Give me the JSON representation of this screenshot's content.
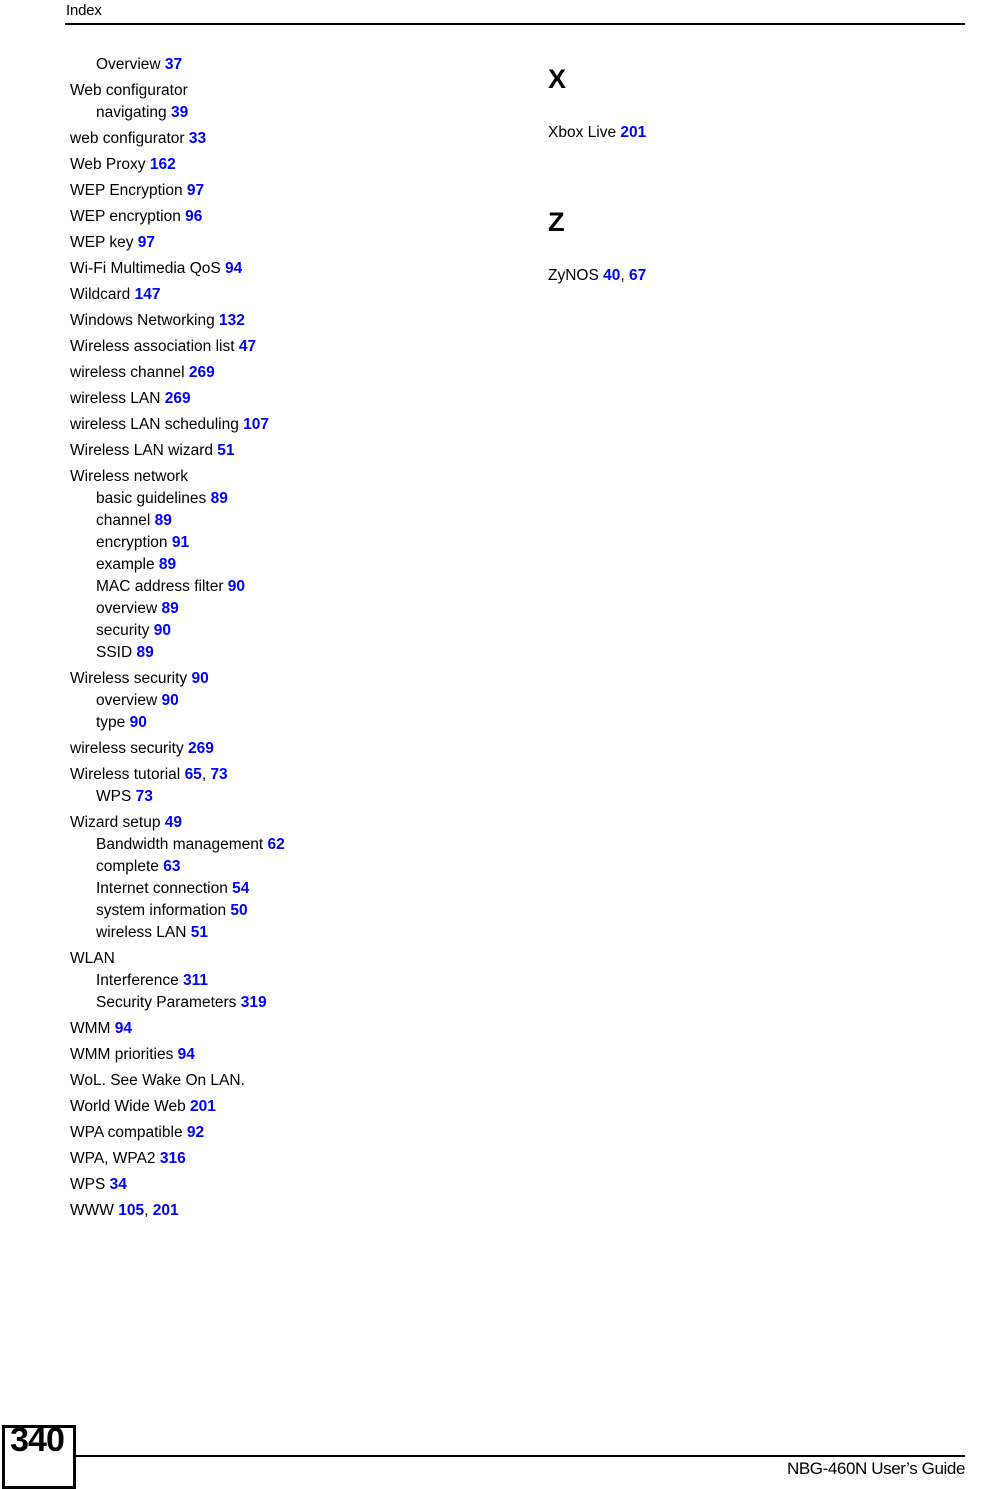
{
  "header": {
    "title": "Index"
  },
  "footer": {
    "page_number": "340",
    "guide_title": "NBG-460N User’s Guide"
  },
  "columns": {
    "left": {
      "entries": [
        {
          "label": "Overview",
          "level": 1,
          "pages": [
            "37"
          ]
        },
        {
          "label": "Web configurator",
          "level": 0,
          "pages": []
        },
        {
          "label": "navigating",
          "level": 1,
          "pages": [
            "39"
          ]
        },
        {
          "label": "web configurator",
          "level": 0,
          "pages": [
            "33"
          ]
        },
        {
          "label": "Web Proxy",
          "level": 0,
          "pages": [
            "162"
          ]
        },
        {
          "label": "WEP Encryption",
          "level": 0,
          "pages": [
            "97"
          ]
        },
        {
          "label": "WEP encryption",
          "level": 0,
          "pages": [
            "96"
          ]
        },
        {
          "label": "WEP key",
          "level": 0,
          "pages": [
            "97"
          ]
        },
        {
          "label": "Wi-Fi Multimedia QoS",
          "level": 0,
          "pages": [
            "94"
          ]
        },
        {
          "label": "Wildcard",
          "level": 0,
          "pages": [
            "147"
          ]
        },
        {
          "label": "Windows Networking",
          "level": 0,
          "pages": [
            "132"
          ]
        },
        {
          "label": "Wireless association list",
          "level": 0,
          "pages": [
            "47"
          ]
        },
        {
          "label": "wireless channel",
          "level": 0,
          "pages": [
            "269"
          ]
        },
        {
          "label": "wireless LAN",
          "level": 0,
          "pages": [
            "269"
          ]
        },
        {
          "label": "wireless LAN scheduling",
          "level": 0,
          "pages": [
            "107"
          ]
        },
        {
          "label": "Wireless LAN wizard",
          "level": 0,
          "pages": [
            "51"
          ]
        },
        {
          "label": "Wireless network",
          "level": 0,
          "pages": []
        },
        {
          "label": "basic guidelines",
          "level": 1,
          "pages": [
            "89"
          ]
        },
        {
          "label": "channel",
          "level": 1,
          "pages": [
            "89"
          ]
        },
        {
          "label": "encryption",
          "level": 1,
          "pages": [
            "91"
          ]
        },
        {
          "label": "example",
          "level": 1,
          "pages": [
            "89"
          ]
        },
        {
          "label": "MAC address filter",
          "level": 1,
          "pages": [
            "90"
          ]
        },
        {
          "label": "overview",
          "level": 1,
          "pages": [
            "89"
          ]
        },
        {
          "label": "security",
          "level": 1,
          "pages": [
            "90"
          ]
        },
        {
          "label": "SSID",
          "level": 1,
          "pages": [
            "89"
          ]
        },
        {
          "label": "Wireless security",
          "level": 0,
          "pages": [
            "90"
          ]
        },
        {
          "label": "overview",
          "level": 1,
          "pages": [
            "90"
          ]
        },
        {
          "label": "type",
          "level": 1,
          "pages": [
            "90"
          ]
        },
        {
          "label": "wireless security",
          "level": 0,
          "pages": [
            "269"
          ]
        },
        {
          "label": "Wireless tutorial",
          "level": 0,
          "pages": [
            "65",
            "73"
          ]
        },
        {
          "label": "WPS",
          "level": 1,
          "pages": [
            "73"
          ]
        },
        {
          "label": "Wizard setup",
          "level": 0,
          "pages": [
            "49"
          ]
        },
        {
          "label": "Bandwidth management",
          "level": 1,
          "pages": [
            "62"
          ]
        },
        {
          "label": "complete",
          "level": 1,
          "pages": [
            "63"
          ]
        },
        {
          "label": "Internet connection",
          "level": 1,
          "pages": [
            "54"
          ]
        },
        {
          "label": "system information",
          "level": 1,
          "pages": [
            "50"
          ]
        },
        {
          "label": "wireless LAN",
          "level": 1,
          "pages": [
            "51"
          ]
        },
        {
          "label": "WLAN",
          "level": 0,
          "pages": []
        },
        {
          "label": "Interference",
          "level": 1,
          "pages": [
            "311"
          ]
        },
        {
          "label": "Security Parameters",
          "level": 1,
          "pages": [
            "319"
          ]
        },
        {
          "label": "WMM",
          "level": 0,
          "pages": [
            "94"
          ]
        },
        {
          "label": "WMM priorities",
          "level": 0,
          "pages": [
            "94"
          ]
        },
        {
          "label": "WoL. See Wake On LAN.",
          "level": 0,
          "pages": []
        },
        {
          "label": "World Wide Web",
          "level": 0,
          "pages": [
            "201"
          ]
        },
        {
          "label": "WPA compatible",
          "level": 0,
          "pages": [
            "92"
          ]
        },
        {
          "label": "WPA, WPA2",
          "level": 0,
          "pages": [
            "316"
          ]
        },
        {
          "label": "WPS",
          "level": 0,
          "pages": [
            "34"
          ]
        },
        {
          "label": "WWW",
          "level": 0,
          "pages": [
            "105",
            "201"
          ]
        }
      ]
    },
    "right": {
      "sections": [
        {
          "heading": "X",
          "entries": [
            {
              "label": "Xbox Live",
              "level": 0,
              "pages": [
                "201"
              ]
            }
          ]
        },
        {
          "heading": "Z",
          "entries": [
            {
              "label": "ZyNOS",
              "level": 0,
              "pages": [
                "40",
                "67"
              ]
            }
          ]
        }
      ]
    }
  }
}
